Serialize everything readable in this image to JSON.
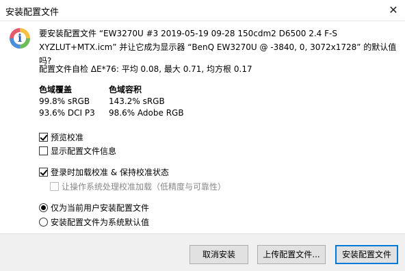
{
  "window": {
    "title": "安装配置文件",
    "close_label": "✕"
  },
  "icon": {
    "name": "info-icon",
    "glyph": "i"
  },
  "question": "要安装配置文件 “EW3270U #3 2019-05-19 09-28 150cdm2 D6500 2.4 F-S XYZLUT+MTX.icm” 并让它成为显示器 “BenQ EW3270U @ -3840, 0, 3072x1728” 的默认值吗?",
  "self_check": "配置文件自检 ΔE*76: 平均 0.08, 最大 0.71, 均方根 0.17",
  "gamut": {
    "coverage_header": "色域覆盖",
    "volume_header": "色域容积",
    "coverage": [
      "99.8% sRGB",
      "93.6% DCI P3"
    ],
    "volume": [
      "143.2% sRGB",
      "98.6% Adobe RGB"
    ]
  },
  "options": {
    "preview_calibration": {
      "label": "预览校准",
      "checked": true
    },
    "show_profile_info": {
      "label": "显示配置文件信息",
      "checked": false
    },
    "load_on_login": {
      "label": "登录时加载校准 & 保持校准状态",
      "checked": true
    },
    "let_os_handle": {
      "label": "让操作系统处理校准加载（低精度与可靠性）",
      "checked": false,
      "disabled": true
    }
  },
  "install_scope": {
    "current_user": {
      "label": "仅为当前用户安装配置文件",
      "selected": true
    },
    "system_default": {
      "label": "安装配置文件为系统默认值",
      "selected": false
    }
  },
  "buttons": {
    "cancel": "取消安装",
    "upload": "上传配置文件...",
    "install": "安装配置文件"
  }
}
